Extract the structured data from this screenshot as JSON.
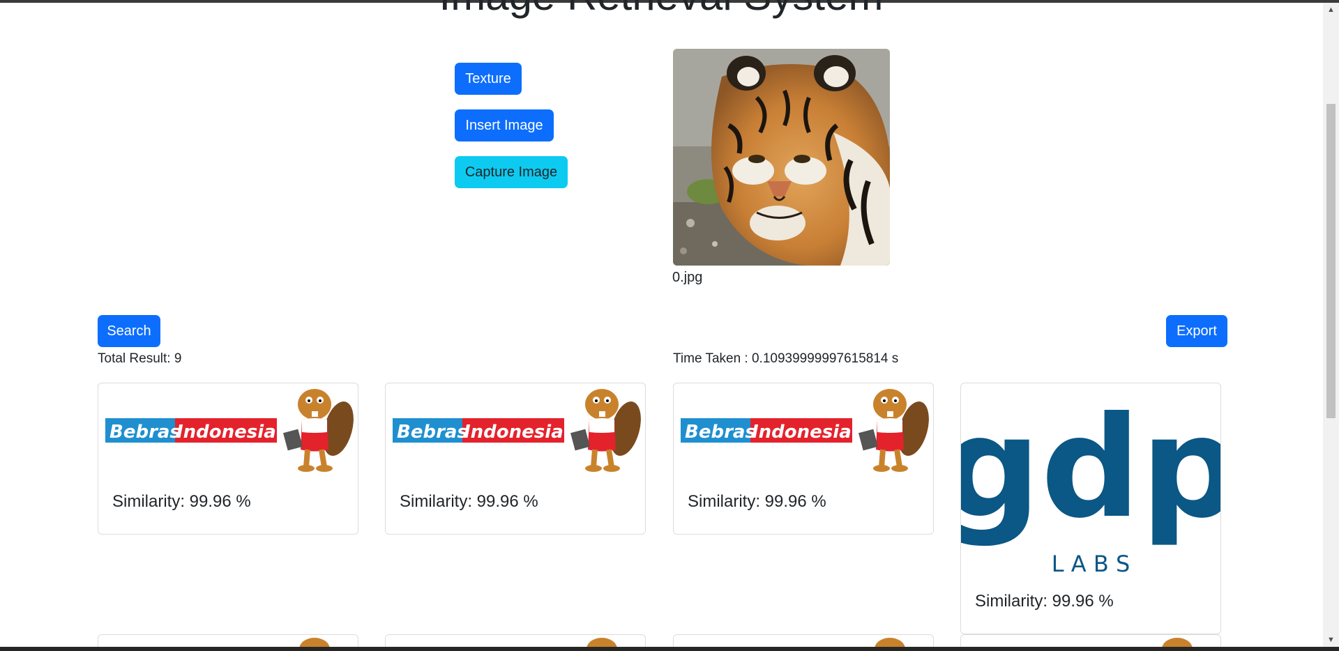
{
  "page": {
    "title": "Image Retrieval System"
  },
  "controls": {
    "texture_label": "Texture",
    "insert_image_label": "Insert Image",
    "capture_image_label": "Capture Image",
    "search_label": "Search",
    "export_label": "Export"
  },
  "query": {
    "filename": "0.jpg"
  },
  "results": {
    "total_text": "Total Result: 9",
    "time_text": "Time Taken : 0.10939999997615814 s",
    "items": [
      {
        "logo": "bebras-indonesia",
        "logo_text_a": "Bebras",
        "logo_text_b": "Indonesia",
        "similarity": "Similarity: 99.96 %"
      },
      {
        "logo": "bebras-indonesia",
        "logo_text_a": "Bebras",
        "logo_text_b": "Indonesia",
        "similarity": "Similarity: 99.96 %"
      },
      {
        "logo": "bebras-indonesia",
        "logo_text_a": "Bebras",
        "logo_text_b": "Indonesia",
        "similarity": "Similarity: 99.96 %"
      },
      {
        "logo": "gdp-labs",
        "logo_text_a": "gdp",
        "logo_text_b": "L A B S",
        "similarity": "Similarity: 99.96 %"
      }
    ]
  },
  "colors": {
    "primary": "#0d6efd",
    "info": "#0dcaf0",
    "gdp_blue": "#0b5785",
    "bebras_blue": "#1f8fd0",
    "bebras_red": "#e3222c"
  }
}
